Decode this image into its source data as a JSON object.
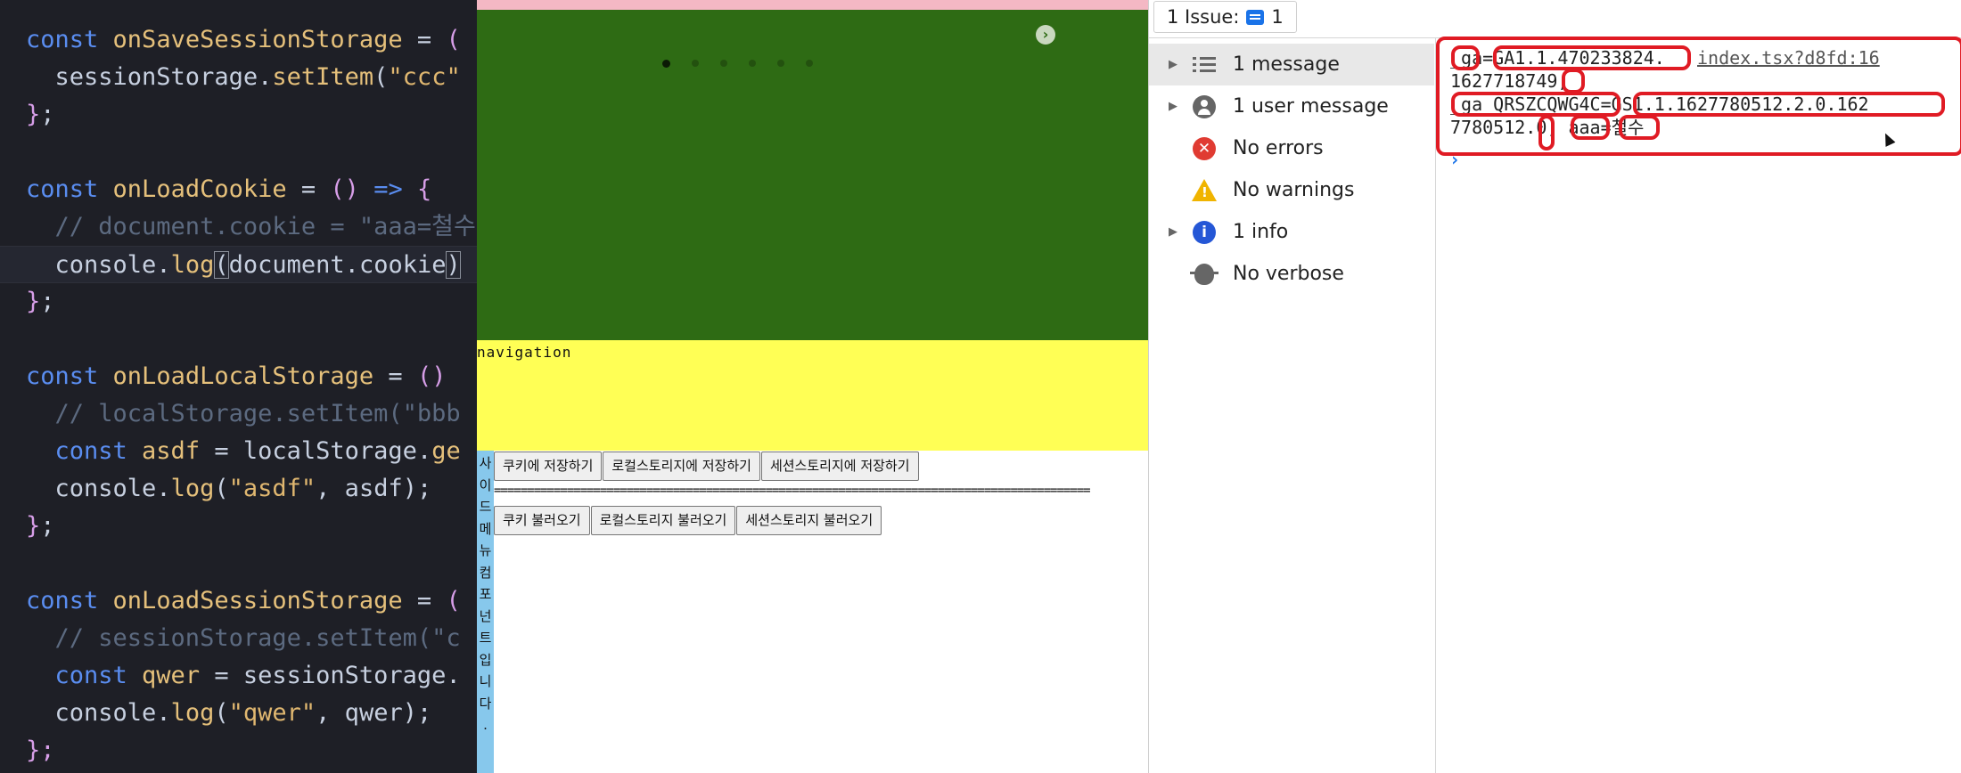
{
  "editor": {
    "lines": [
      [
        {
          "t": "const ",
          "c": "k"
        },
        {
          "t": "onSaveSessionStorage",
          "c": "f"
        },
        {
          "t": " = ",
          "c": "v"
        },
        {
          "t": "(",
          "c": "br"
        }
      ],
      [
        {
          "t": "  sessionStorage",
          "c": "v"
        },
        {
          "t": ".",
          "c": "v"
        },
        {
          "t": "setItem",
          "c": "f"
        },
        {
          "t": "(",
          "c": "v"
        },
        {
          "t": "\"ccc\"",
          "c": "s"
        }
      ],
      [
        {
          "t": "}",
          "c": "p"
        },
        {
          "t": ";",
          "c": "v"
        }
      ],
      [],
      [
        {
          "t": "const ",
          "c": "k"
        },
        {
          "t": "onLoadCookie",
          "c": "f"
        },
        {
          "t": " = ",
          "c": "v"
        },
        {
          "t": "() ",
          "c": "br"
        },
        {
          "t": "=> ",
          "c": "k"
        },
        {
          "t": "{",
          "c": "br"
        }
      ],
      [
        {
          "t": "  // document.cookie = \"aaa=철수",
          "c": "c"
        }
      ],
      [
        {
          "t": "  console",
          "c": "v"
        },
        {
          "t": ".",
          "c": "v"
        },
        {
          "t": "log",
          "c": "f"
        },
        {
          "t": "(",
          "c": "v",
          "b": true
        },
        {
          "t": "document",
          "c": "v"
        },
        {
          "t": ".",
          "c": "v"
        },
        {
          "t": "cookie",
          "c": "v"
        },
        {
          "t": ")",
          "c": "v",
          "b": true
        }
      ],
      [
        {
          "t": "}",
          "c": "p"
        },
        {
          "t": ";",
          "c": "v"
        }
      ],
      [],
      [
        {
          "t": "const ",
          "c": "k"
        },
        {
          "t": "onLoadLocalStorage",
          "c": "f"
        },
        {
          "t": " = ",
          "c": "v"
        },
        {
          "t": "() ",
          "c": "br"
        }
      ],
      [
        {
          "t": "  // localStorage.setItem(\"bbb",
          "c": "c"
        }
      ],
      [
        {
          "t": "  const ",
          "c": "k"
        },
        {
          "t": "asdf",
          "c": "f"
        },
        {
          "t": " = ",
          "c": "v"
        },
        {
          "t": "localStorage",
          "c": "v"
        },
        {
          "t": ".",
          "c": "v"
        },
        {
          "t": "ge",
          "c": "f"
        }
      ],
      [
        {
          "t": "  console",
          "c": "v"
        },
        {
          "t": ".",
          "c": "v"
        },
        {
          "t": "log",
          "c": "f"
        },
        {
          "t": "(",
          "c": "v"
        },
        {
          "t": "\"asdf\"",
          "c": "s"
        },
        {
          "t": ", asdf);",
          "c": "v"
        }
      ],
      [
        {
          "t": "}",
          "c": "p"
        },
        {
          "t": ";",
          "c": "v"
        }
      ],
      [],
      [
        {
          "t": "const ",
          "c": "k"
        },
        {
          "t": "onLoadSessionStorage",
          "c": "f"
        },
        {
          "t": " = ",
          "c": "v"
        },
        {
          "t": "(",
          "c": "br"
        }
      ],
      [
        {
          "t": "  // sessionStorage.setItem(\"c",
          "c": "c"
        }
      ],
      [
        {
          "t": "  const ",
          "c": "k"
        },
        {
          "t": "qwer",
          "c": "f"
        },
        {
          "t": " = ",
          "c": "v"
        },
        {
          "t": "sessionStorage",
          "c": "v"
        },
        {
          "t": ".",
          "c": "v"
        }
      ],
      [
        {
          "t": "  console",
          "c": "v"
        },
        {
          "t": ".",
          "c": "v"
        },
        {
          "t": "log",
          "c": "f"
        },
        {
          "t": "(",
          "c": "v"
        },
        {
          "t": "\"qwer\"",
          "c": "s"
        },
        {
          "t": ", qwer);",
          "c": "v"
        }
      ],
      [
        {
          "t": "};",
          "c": "p"
        }
      ]
    ]
  },
  "page": {
    "nav_label": "navigation",
    "sidebar_text": "사이드메뉴컴포넌트입니다.",
    "save_buttons": [
      "쿠키에 저장하기",
      "로컬스토리지에 저장하기",
      "세션스토리지에 저장하기"
    ],
    "divider": "==========================================================================================",
    "load_buttons": [
      "쿠키 불러오기",
      "로컬스토리지 불러오기",
      "세션스토리지 불러오기"
    ],
    "banner_color": "#2e6b14",
    "nav_color": "#ffff55",
    "sidebar_color": "#87c8ec"
  },
  "devtools": {
    "issues_label": "1 Issue:",
    "issues_count": "1",
    "sidebar": [
      {
        "label": "1 message",
        "icon": "list-icon",
        "expand": true
      },
      {
        "label": "1 user message",
        "icon": "user-icon",
        "expand": true
      },
      {
        "label": "No errors",
        "icon": "error-icon",
        "expand": false
      },
      {
        "label": "No warnings",
        "icon": "warning-icon",
        "expand": false
      },
      {
        "label": "1 info",
        "icon": "info-icon",
        "expand": true
      },
      {
        "label": "No verbose",
        "icon": "bug-icon",
        "expand": false
      }
    ],
    "console": {
      "line1": "_ga=GA1.1.470233824.",
      "source": "index.tsx?d8fd:16",
      "line2": "1627718749;",
      "line3": "_ga_QRSZCQWG4C=GS1.1.1627780512.2.0.162",
      "line4": "7780512.0; aaa=철수",
      "prompt": "›",
      "annotation_color": "#e01b24"
    }
  }
}
